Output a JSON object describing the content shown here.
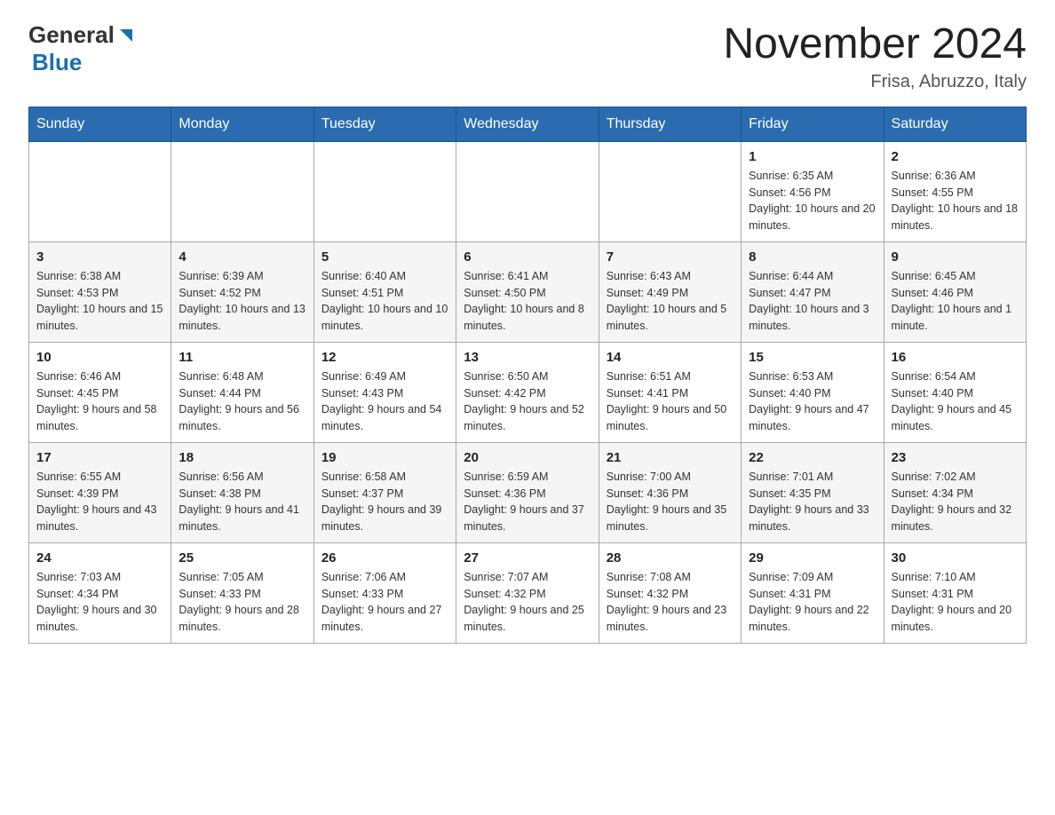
{
  "header": {
    "logo_general": "General",
    "logo_blue": "Blue",
    "month_title": "November 2024",
    "location": "Frisa, Abruzzo, Italy"
  },
  "days_of_week": [
    "Sunday",
    "Monday",
    "Tuesday",
    "Wednesday",
    "Thursday",
    "Friday",
    "Saturday"
  ],
  "weeks": [
    [
      {
        "day": "",
        "info": ""
      },
      {
        "day": "",
        "info": ""
      },
      {
        "day": "",
        "info": ""
      },
      {
        "day": "",
        "info": ""
      },
      {
        "day": "",
        "info": ""
      },
      {
        "day": "1",
        "info": "Sunrise: 6:35 AM\nSunset: 4:56 PM\nDaylight: 10 hours and 20 minutes."
      },
      {
        "day": "2",
        "info": "Sunrise: 6:36 AM\nSunset: 4:55 PM\nDaylight: 10 hours and 18 minutes."
      }
    ],
    [
      {
        "day": "3",
        "info": "Sunrise: 6:38 AM\nSunset: 4:53 PM\nDaylight: 10 hours and 15 minutes."
      },
      {
        "day": "4",
        "info": "Sunrise: 6:39 AM\nSunset: 4:52 PM\nDaylight: 10 hours and 13 minutes."
      },
      {
        "day": "5",
        "info": "Sunrise: 6:40 AM\nSunset: 4:51 PM\nDaylight: 10 hours and 10 minutes."
      },
      {
        "day": "6",
        "info": "Sunrise: 6:41 AM\nSunset: 4:50 PM\nDaylight: 10 hours and 8 minutes."
      },
      {
        "day": "7",
        "info": "Sunrise: 6:43 AM\nSunset: 4:49 PM\nDaylight: 10 hours and 5 minutes."
      },
      {
        "day": "8",
        "info": "Sunrise: 6:44 AM\nSunset: 4:47 PM\nDaylight: 10 hours and 3 minutes."
      },
      {
        "day": "9",
        "info": "Sunrise: 6:45 AM\nSunset: 4:46 PM\nDaylight: 10 hours and 1 minute."
      }
    ],
    [
      {
        "day": "10",
        "info": "Sunrise: 6:46 AM\nSunset: 4:45 PM\nDaylight: 9 hours and 58 minutes."
      },
      {
        "day": "11",
        "info": "Sunrise: 6:48 AM\nSunset: 4:44 PM\nDaylight: 9 hours and 56 minutes."
      },
      {
        "day": "12",
        "info": "Sunrise: 6:49 AM\nSunset: 4:43 PM\nDaylight: 9 hours and 54 minutes."
      },
      {
        "day": "13",
        "info": "Sunrise: 6:50 AM\nSunset: 4:42 PM\nDaylight: 9 hours and 52 minutes."
      },
      {
        "day": "14",
        "info": "Sunrise: 6:51 AM\nSunset: 4:41 PM\nDaylight: 9 hours and 50 minutes."
      },
      {
        "day": "15",
        "info": "Sunrise: 6:53 AM\nSunset: 4:40 PM\nDaylight: 9 hours and 47 minutes."
      },
      {
        "day": "16",
        "info": "Sunrise: 6:54 AM\nSunset: 4:40 PM\nDaylight: 9 hours and 45 minutes."
      }
    ],
    [
      {
        "day": "17",
        "info": "Sunrise: 6:55 AM\nSunset: 4:39 PM\nDaylight: 9 hours and 43 minutes."
      },
      {
        "day": "18",
        "info": "Sunrise: 6:56 AM\nSunset: 4:38 PM\nDaylight: 9 hours and 41 minutes."
      },
      {
        "day": "19",
        "info": "Sunrise: 6:58 AM\nSunset: 4:37 PM\nDaylight: 9 hours and 39 minutes."
      },
      {
        "day": "20",
        "info": "Sunrise: 6:59 AM\nSunset: 4:36 PM\nDaylight: 9 hours and 37 minutes."
      },
      {
        "day": "21",
        "info": "Sunrise: 7:00 AM\nSunset: 4:36 PM\nDaylight: 9 hours and 35 minutes."
      },
      {
        "day": "22",
        "info": "Sunrise: 7:01 AM\nSunset: 4:35 PM\nDaylight: 9 hours and 33 minutes."
      },
      {
        "day": "23",
        "info": "Sunrise: 7:02 AM\nSunset: 4:34 PM\nDaylight: 9 hours and 32 minutes."
      }
    ],
    [
      {
        "day": "24",
        "info": "Sunrise: 7:03 AM\nSunset: 4:34 PM\nDaylight: 9 hours and 30 minutes."
      },
      {
        "day": "25",
        "info": "Sunrise: 7:05 AM\nSunset: 4:33 PM\nDaylight: 9 hours and 28 minutes."
      },
      {
        "day": "26",
        "info": "Sunrise: 7:06 AM\nSunset: 4:33 PM\nDaylight: 9 hours and 27 minutes."
      },
      {
        "day": "27",
        "info": "Sunrise: 7:07 AM\nSunset: 4:32 PM\nDaylight: 9 hours and 25 minutes."
      },
      {
        "day": "28",
        "info": "Sunrise: 7:08 AM\nSunset: 4:32 PM\nDaylight: 9 hours and 23 minutes."
      },
      {
        "day": "29",
        "info": "Sunrise: 7:09 AM\nSunset: 4:31 PM\nDaylight: 9 hours and 22 minutes."
      },
      {
        "day": "30",
        "info": "Sunrise: 7:10 AM\nSunset: 4:31 PM\nDaylight: 9 hours and 20 minutes."
      }
    ]
  ]
}
